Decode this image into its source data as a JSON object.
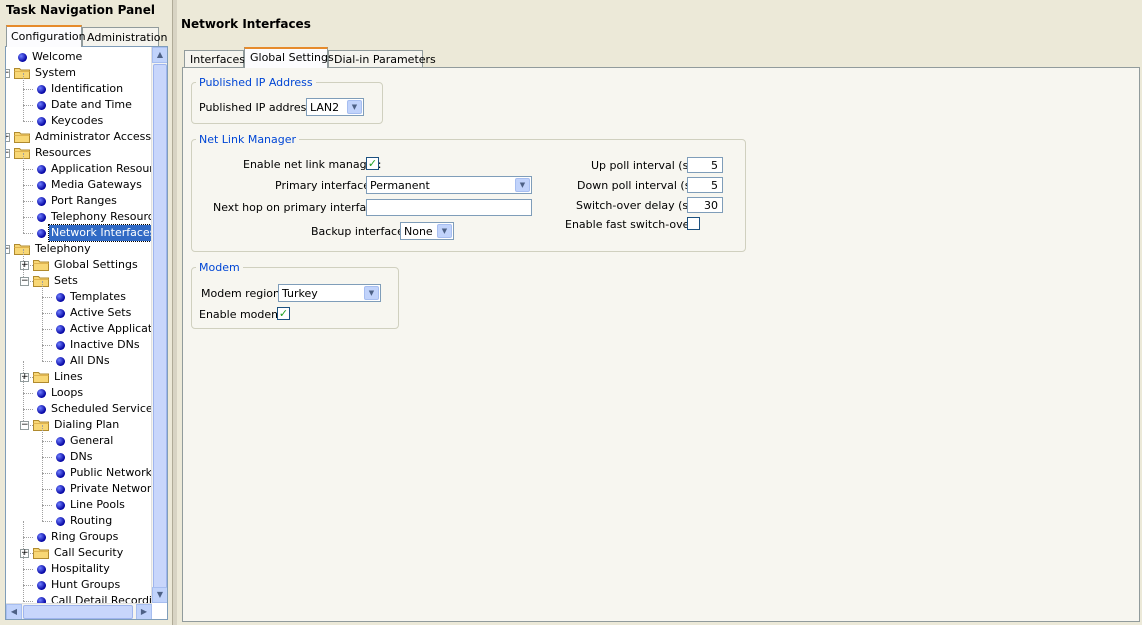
{
  "nav": {
    "title": "Task Navigation Panel",
    "tabs": [
      "Configuration",
      "Administration"
    ],
    "tree": [
      {
        "label": "Welcome",
        "kind": "leaf",
        "depth": 0
      },
      {
        "label": "System",
        "kind": "folder",
        "depth": 0,
        "state": "expanded"
      },
      {
        "label": "Identification",
        "kind": "leaf",
        "depth": 1
      },
      {
        "label": "Date and Time",
        "kind": "leaf",
        "depth": 1
      },
      {
        "label": "Keycodes",
        "kind": "leaf",
        "depth": 1
      },
      {
        "label": "Administrator Access",
        "kind": "folder",
        "depth": 0,
        "state": "collapsed"
      },
      {
        "label": "Resources",
        "kind": "folder",
        "depth": 0,
        "state": "expanded"
      },
      {
        "label": "Application Resource",
        "kind": "leaf",
        "depth": 1
      },
      {
        "label": "Media Gateways",
        "kind": "leaf",
        "depth": 1
      },
      {
        "label": "Port Ranges",
        "kind": "leaf",
        "depth": 1
      },
      {
        "label": "Telephony Resource",
        "kind": "leaf",
        "depth": 1
      },
      {
        "label": "Network Interfaces",
        "kind": "leaf",
        "depth": 1,
        "selected": true
      },
      {
        "label": "Telephony",
        "kind": "folder",
        "depth": 0,
        "state": "expanded"
      },
      {
        "label": "Global Settings",
        "kind": "folder",
        "depth": 1,
        "state": "collapsed"
      },
      {
        "label": "Sets",
        "kind": "folder",
        "depth": 1,
        "state": "expanded"
      },
      {
        "label": "Templates",
        "kind": "leaf",
        "depth": 2
      },
      {
        "label": "Active Sets",
        "kind": "leaf",
        "depth": 2
      },
      {
        "label": "Active Applicatio",
        "kind": "leaf",
        "depth": 2
      },
      {
        "label": "Inactive DNs",
        "kind": "leaf",
        "depth": 2
      },
      {
        "label": "All DNs",
        "kind": "leaf",
        "depth": 2
      },
      {
        "label": "Lines",
        "kind": "folder",
        "depth": 1,
        "state": "collapsed"
      },
      {
        "label": "Loops",
        "kind": "leaf",
        "depth": 1
      },
      {
        "label": "Scheduled Services",
        "kind": "leaf",
        "depth": 1
      },
      {
        "label": "Dialing Plan",
        "kind": "folder",
        "depth": 1,
        "state": "expanded"
      },
      {
        "label": "General",
        "kind": "leaf",
        "depth": 2
      },
      {
        "label": "DNs",
        "kind": "leaf",
        "depth": 2
      },
      {
        "label": "Public Network",
        "kind": "leaf",
        "depth": 2
      },
      {
        "label": "Private Network",
        "kind": "leaf",
        "depth": 2
      },
      {
        "label": "Line Pools",
        "kind": "leaf",
        "depth": 2
      },
      {
        "label": "Routing",
        "kind": "leaf",
        "depth": 2
      },
      {
        "label": "Ring Groups",
        "kind": "leaf",
        "depth": 1
      },
      {
        "label": "Call Security",
        "kind": "folder",
        "depth": 1,
        "state": "collapsed"
      },
      {
        "label": "Hospitality",
        "kind": "leaf",
        "depth": 1
      },
      {
        "label": "Hunt Groups",
        "kind": "leaf",
        "depth": 1
      },
      {
        "label": "Call Detail Recording",
        "kind": "leaf",
        "depth": 1
      }
    ]
  },
  "main": {
    "title": "Network Interfaces",
    "tabs": [
      "Interfaces",
      "Global Settings",
      "Dial-in Parameters"
    ],
    "published_ip": {
      "legend": "Published IP Address",
      "label": "Published IP address:",
      "value": "LAN2"
    },
    "net_link": {
      "legend": "Net Link Manager",
      "enable_label": "Enable net link manager:",
      "enable_checked": true,
      "primary_label": "Primary interface:",
      "primary_value": "Permanent",
      "next_hop_label": "Next hop on primary interface:",
      "next_hop_value": "",
      "backup_label": "Backup interface:",
      "backup_value": "None",
      "up_poll_label": "Up poll interval (s):",
      "up_poll_value": "5",
      "down_poll_label": "Down poll interval (s):",
      "down_poll_value": "5",
      "switch_delay_label": "Switch-over delay (s):",
      "switch_delay_value": "30",
      "fast_switch_label": "Enable fast switch-over:",
      "fast_switch_checked": false
    },
    "modem": {
      "legend": "Modem",
      "region_label": "Modem region:",
      "region_value": "Turkey",
      "enable_label": "Enable modem:",
      "enable_checked": true
    }
  },
  "colors": {
    "selection": "#316ac5",
    "group_legend": "#0046d5",
    "tab_highlight": "#e68b2c",
    "check_mark": "#21a121"
  }
}
